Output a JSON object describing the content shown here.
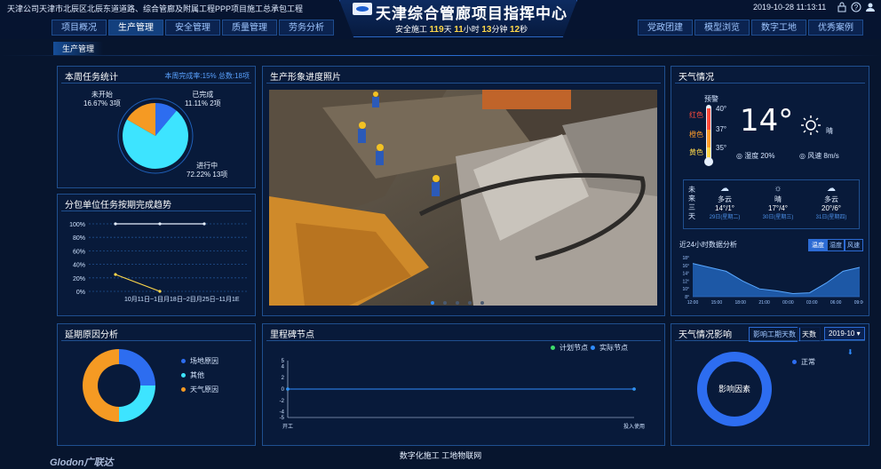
{
  "header": {
    "company": "天津公司天津市北辰区北辰东道道路、综合管廊及附属工程PPP项目施工总承包工程",
    "title": "天津综合管廊项目指挥中心",
    "safety": {
      "prefix": "安全施工",
      "days": "119",
      "d": "天",
      "hours": "11",
      "h": "小时",
      "minutes": "13",
      "m": "分钟",
      "seconds": "12",
      "s": "秒"
    },
    "datetime": "2019-10-28 11:13:11",
    "nav_left": [
      "项目概况",
      "生产管理",
      "安全管理",
      "质量管理",
      "劳务分析"
    ],
    "nav_right": [
      "党政团建",
      "模型浏览",
      "数字工地",
      "优秀案例"
    ],
    "subnav": "生产管理"
  },
  "task_stats": {
    "title": "本周任务统计",
    "summary": "本周完成率:15%  总数:18项",
    "slices": [
      {
        "name": "未开始",
        "pct": "16.67%",
        "count": "3项",
        "value": 16.67,
        "color": "#f59a23"
      },
      {
        "name": "已完成",
        "pct": "11.11%",
        "count": "2项",
        "value": 11.11,
        "color": "#2d6df0"
      },
      {
        "name": "进行中",
        "pct": "72.22%",
        "count": "13项",
        "value": 72.22,
        "color": "#3de4ff"
      }
    ]
  },
  "subcontract": {
    "title": "分包单位任务按期完成趋势",
    "chart_data": {
      "type": "line",
      "categories": [
        "10月11日~17日",
        "10月18日~24日",
        "10月25日~11月1日"
      ],
      "yticks": [
        "100%",
        "80%",
        "60%",
        "40%",
        "20%",
        "0%"
      ],
      "ylim": [
        0,
        100
      ],
      "x_labels_text": "10月11日~1目月18日~2目月25日~11月1E",
      "series": [
        {
          "values": [
            100,
            100,
            100
          ],
          "color": "#e6f0ff"
        },
        {
          "values": [
            25,
            0,
            null
          ],
          "color": "#ffd84a"
        }
      ]
    }
  },
  "photo": {
    "title": "生产形象进度照片",
    "dots": 5,
    "active": 0
  },
  "weather": {
    "title": "天气情况",
    "warning": "预警",
    "levels": [
      "红色",
      "橙色",
      "黄色"
    ],
    "thermo": [
      "40°",
      "37°",
      "35°"
    ],
    "temp": "14°",
    "condition": "晴",
    "humidity": "湿度 20%",
    "wind": "风速 8m/s",
    "future_label": "未来三天",
    "forecast": [
      {
        "icon": "cloud-icon",
        "cond": "多云",
        "range": "14°/1°",
        "date": "29日(星期二)"
      },
      {
        "icon": "sun-icon",
        "cond": "晴",
        "range": "17°/4°",
        "date": "30日(星期三)"
      },
      {
        "icon": "cloud-icon",
        "cond": "多云",
        "range": "20°/6°",
        "date": "31日(星期四)"
      }
    ],
    "hourly_title": "近24小时数据分析",
    "tabs": [
      "温度",
      "湿度",
      "风速"
    ],
    "chart_data": {
      "type": "area",
      "x": [
        "12:00",
        "15:00",
        "18:00",
        "21:00",
        "00:00",
        "03:00",
        "06:00",
        "09:00"
      ],
      "yticks": [
        "18°",
        "16°",
        "14°",
        "12°",
        "10°",
        "8°"
      ],
      "ylim": [
        8,
        18
      ],
      "values": [
        16.5,
        15.5,
        14.5,
        12.0,
        10.0,
        9.5,
        8.8,
        9.0,
        11.5,
        14.5,
        15.5
      ]
    }
  },
  "delay": {
    "title": "延期原因分析",
    "chart_data": {
      "type": "pie",
      "series": [
        {
          "name": "场地原因",
          "value": 25,
          "color": "#2d6df0"
        },
        {
          "name": "其他",
          "value": 25,
          "color": "#3de4ff"
        },
        {
          "name": "天气原因",
          "value": 50,
          "color": "#f59a23"
        }
      ]
    }
  },
  "milestone": {
    "title": "里程碑节点",
    "chart_data": {
      "type": "line",
      "legend": [
        "计划节点",
        "实际节点"
      ],
      "categories": [
        "开工",
        "投入使用"
      ],
      "yticks": [
        "5",
        "4",
        "2",
        "0",
        "-2",
        "-4",
        "-5"
      ],
      "ylim": [
        -5,
        5
      ],
      "series": [
        {
          "name": "计划节点",
          "values": [
            0,
            0
          ],
          "color": "#3ddc6a"
        },
        {
          "name": "实际节点",
          "values": [
            0,
            0
          ],
          "color": "#2f8cff"
        }
      ]
    }
  },
  "weather_impact": {
    "title": "天气情况影响",
    "btn_days": "影响工期天数",
    "btn_unit": "天数",
    "month": "2019-10",
    "legend": "正常",
    "center": "影响因素",
    "color": "#2d6df0"
  },
  "footer": "数字化施工 工地物联网",
  "brand": "Glodon广联达"
}
